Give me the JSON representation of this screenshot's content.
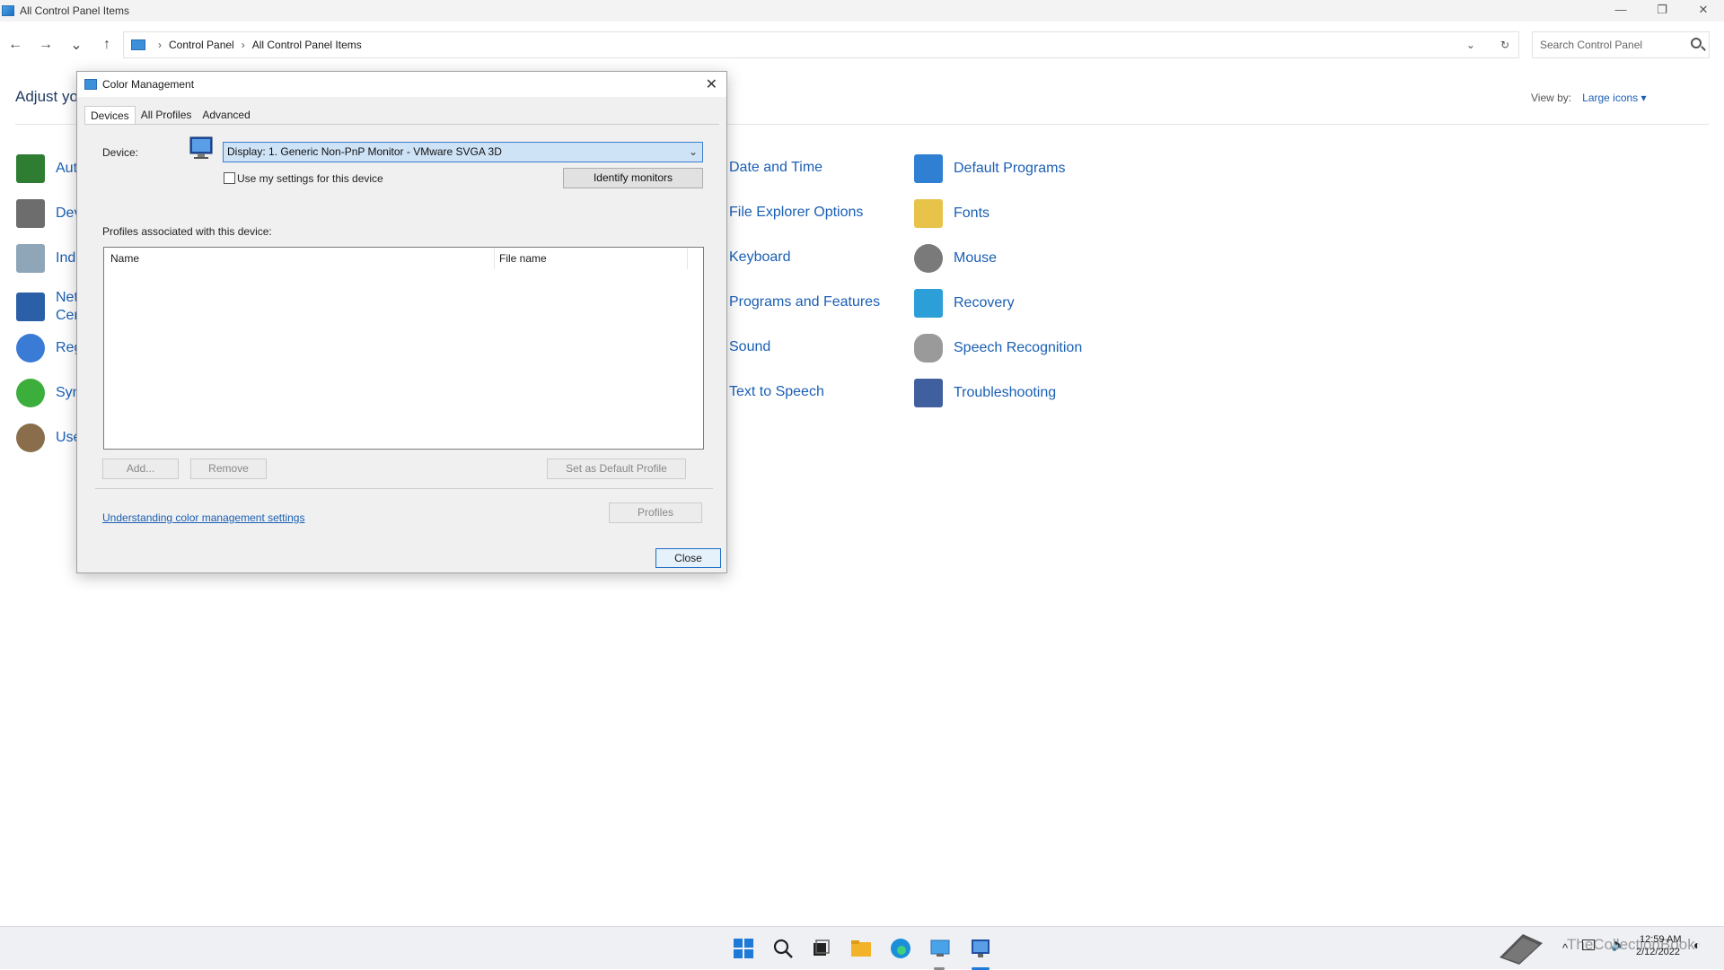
{
  "window": {
    "title": "All Control Panel Items",
    "minimize": "—",
    "maximize": "❐",
    "close": "✕"
  },
  "nav": {
    "back": "←",
    "forward": "→",
    "recent": "⌄",
    "up": "↑"
  },
  "address": {
    "crumbs": [
      "Control Panel",
      "All Control Panel Items"
    ],
    "dropdown": "⌄",
    "refresh": "↻"
  },
  "search": {
    "placeholder": "Search Control Panel"
  },
  "heading": "Adjust you",
  "view_by": {
    "label": "View by:",
    "value": "Large icons ▾"
  },
  "left_items": [
    "Aut",
    "Dev",
    "Inde",
    "Net\nCen",
    "Reg",
    "Syn",
    "Use"
  ],
  "middle_items": [
    "Date and Time",
    "File Explorer Options",
    "Keyboard",
    "Programs and Features",
    "Sound",
    "Text to Speech"
  ],
  "right_items": [
    "Default Programs",
    "Fonts",
    "Mouse",
    "Recovery",
    "Speech Recognition",
    "Troubleshooting"
  ],
  "dialog": {
    "title": "Color Management",
    "close_glyph": "✕",
    "tabs": [
      "Devices",
      "All Profiles",
      "Advanced"
    ],
    "device_label": "Device:",
    "device_value": "Display: 1. Generic Non-PnP Monitor - VMware SVGA 3D",
    "use_settings": "Use my settings for this device",
    "identify_btn": "Identify monitors",
    "profiles_label": "Profiles associated with this device:",
    "columns": [
      "Name",
      "File name"
    ],
    "add_btn": "Add...",
    "remove_btn": "Remove",
    "default_btn": "Set as Default Profile",
    "link": "Understanding color management settings",
    "profiles_btn": "Profiles",
    "close_btn": "Close"
  },
  "tray": {
    "watermark": "TheCollectionBook",
    "time": "12:59 AM",
    "date": "2/12/2022",
    "chevron": "^"
  }
}
